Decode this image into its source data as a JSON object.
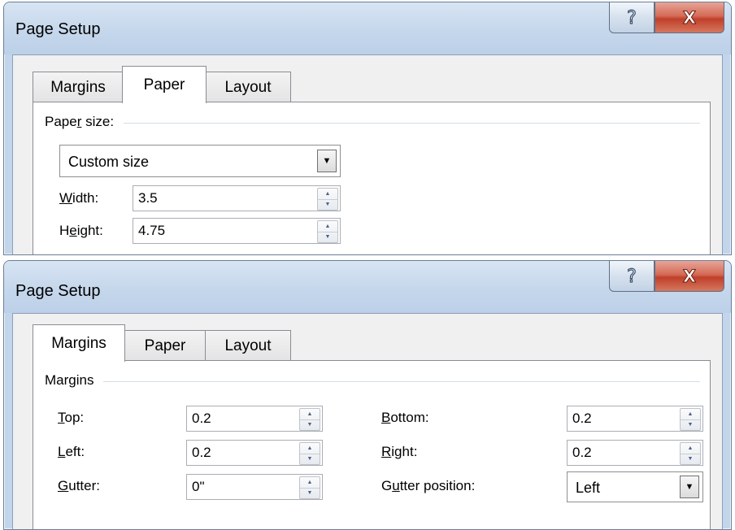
{
  "dialog_top": {
    "title": "Page Setup",
    "help_glyph": "?",
    "close_glyph": "X",
    "tabs": [
      {
        "label": "Margins",
        "active": false
      },
      {
        "label": "Paper",
        "active": true
      },
      {
        "label": "Layout",
        "active": false
      }
    ],
    "paper_size": {
      "label_pre": "Pape",
      "label_accel": "r",
      "label_post": " size:",
      "selected": "Custom size"
    },
    "width": {
      "label_accel": "W",
      "label_rest": "idth:",
      "value": "3.5"
    },
    "height": {
      "label_pre": "H",
      "label_accel": "e",
      "label_rest": "ight:",
      "value": "4.75"
    }
  },
  "dialog_bottom": {
    "title": "Page Setup",
    "help_glyph": "?",
    "close_glyph": "X",
    "tabs": [
      {
        "label": "Margins",
        "active": true
      },
      {
        "label": "Paper",
        "active": false
      },
      {
        "label": "Layout",
        "active": false
      }
    ],
    "margins_group": "Margins",
    "top": {
      "label_accel": "T",
      "label_rest": "op:",
      "value": "0.2"
    },
    "left": {
      "label_accel": "L",
      "label_rest": "eft:",
      "value": "0.2"
    },
    "gutter": {
      "label_accel": "G",
      "label_rest": "utter:",
      "value": "0\""
    },
    "bottom": {
      "label_accel": "B",
      "label_rest": "ottom:",
      "value": "0.2"
    },
    "right": {
      "label_accel": "R",
      "label_rest": "ight:",
      "value": "0.2"
    },
    "gutter_position": {
      "label_pre": "G",
      "label_accel": "u",
      "label_rest": "tter position:",
      "value": "Left"
    }
  },
  "colors": {
    "title_bar": "#c4d6eb",
    "close_button": "#c0402a",
    "client_bg": "#f0f0f0",
    "panel_bg": "#ffffff"
  }
}
